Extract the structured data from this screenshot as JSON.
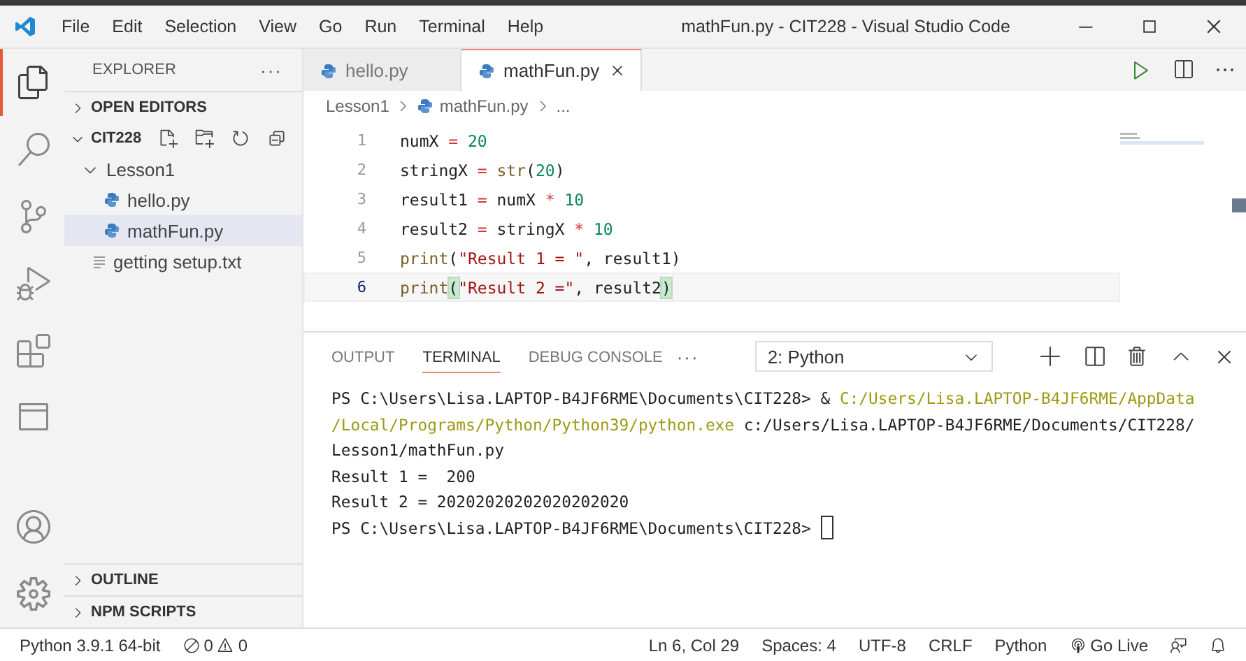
{
  "window": {
    "title": "mathFun.py - CIT228 - Visual Studio Code"
  },
  "menu": [
    "File",
    "Edit",
    "Selection",
    "View",
    "Go",
    "Run",
    "Terminal",
    "Help"
  ],
  "activity_bar": [
    {
      "kind": "files",
      "selected": true
    },
    {
      "kind": "search",
      "selected": false
    },
    {
      "kind": "scm",
      "selected": false
    },
    {
      "kind": "debug",
      "selected": false
    },
    {
      "kind": "extensions",
      "selected": false
    },
    {
      "kind": "browser",
      "selected": false
    }
  ],
  "activity_bottom": [
    {
      "kind": "account"
    },
    {
      "kind": "settings"
    }
  ],
  "sidebar": {
    "title": "EXPLORER",
    "more": "···",
    "sections_top": [
      {
        "label": "OPEN EDITORS",
        "expanded": false
      }
    ],
    "folder": {
      "label": "CIT228",
      "expanded": true,
      "children": [
        {
          "label": "Lesson1",
          "kind": "folder",
          "expanded": true,
          "selected": false,
          "children": [
            {
              "label": "hello.py",
              "kind": "python",
              "selected": false
            },
            {
              "label": "mathFun.py",
              "kind": "python",
              "selected": true
            }
          ]
        },
        {
          "label": "getting setup.txt",
          "kind": "text",
          "selected": false
        }
      ]
    },
    "sections_bottom": [
      {
        "label": "OUTLINE",
        "expanded": false
      },
      {
        "label": "NPM SCRIPTS",
        "expanded": false
      }
    ]
  },
  "tabs": [
    {
      "label": "hello.py",
      "selected": false
    },
    {
      "label": "mathFun.py",
      "selected": true
    }
  ],
  "breadcrumbs": [
    "Lesson1",
    "mathFun.py",
    "..."
  ],
  "editor": {
    "lines": [
      {
        "number": "1",
        "current": false,
        "tokens": [
          {
            "text": "numX ",
            "kind": "plain"
          },
          {
            "text": "=",
            "kind": "op"
          },
          {
            "text": " 20",
            "kind": "num"
          }
        ]
      },
      {
        "number": "2",
        "current": false,
        "tokens": [
          {
            "text": "stringX ",
            "kind": "plain"
          },
          {
            "text": "= ",
            "kind": "op"
          },
          {
            "text": "str",
            "kind": "fn"
          },
          {
            "text": "(",
            "kind": "plain"
          },
          {
            "text": "20",
            "kind": "num"
          },
          {
            "text": ")",
            "kind": "plain"
          }
        ]
      },
      {
        "number": "3",
        "current": false,
        "tokens": [
          {
            "text": "result1 ",
            "kind": "plain"
          },
          {
            "text": "=",
            "kind": "op"
          },
          {
            "text": " numX ",
            "kind": "plain"
          },
          {
            "text": "*",
            "kind": "op"
          },
          {
            "text": " 10",
            "kind": "num"
          }
        ]
      },
      {
        "number": "4",
        "current": false,
        "tokens": [
          {
            "text": "result2 ",
            "kind": "plain"
          },
          {
            "text": "=",
            "kind": "op"
          },
          {
            "text": " stringX ",
            "kind": "plain"
          },
          {
            "text": "*",
            "kind": "op"
          },
          {
            "text": " 10",
            "kind": "num"
          }
        ]
      },
      {
        "number": "5",
        "current": false,
        "tokens": [
          {
            "text": "print",
            "kind": "fn"
          },
          {
            "text": "(",
            "kind": "plain"
          },
          {
            "text": "\"Result 1 = \"",
            "kind": "str"
          },
          {
            "text": ", result1)",
            "kind": "plain"
          }
        ]
      },
      {
        "number": "6",
        "current": true,
        "tokens": [
          {
            "text": "print",
            "kind": "fn"
          },
          {
            "text": "(",
            "kind": "bracket"
          },
          {
            "text": "\"Result 2 =\"",
            "kind": "str"
          },
          {
            "text": ", result2",
            "kind": "plain"
          },
          {
            "text": ")",
            "kind": "bracket"
          }
        ]
      }
    ]
  },
  "panel": {
    "tabs": [
      {
        "label": "OUTPUT",
        "selected": false
      },
      {
        "label": "TERMINAL",
        "selected": true
      },
      {
        "label": "DEBUG CONSOLE",
        "selected": false
      }
    ],
    "more": "···",
    "terminal_select": "2: Python",
    "lines": [
      [
        {
          "text": "PS C:\\Users\\Lisa.LAPTOP-B4JF6RME\\Documents\\CIT228> & ",
          "kind": "plain"
        },
        {
          "text": "C:/Users/Lisa.LAPTOP-B4JF6RME/AppData",
          "kind": "path"
        }
      ],
      [
        {
          "text": "/Local/Programs/Python/Python39/python.exe",
          "kind": "path"
        },
        {
          "text": " c:/Users/Lisa.LAPTOP-B4JF6RME/Documents/CIT228/",
          "kind": "plain"
        }
      ],
      [
        {
          "text": "Lesson1/mathFun.py",
          "kind": "plain"
        }
      ],
      [
        {
          "text": "Result 1 =  200",
          "kind": "plain"
        }
      ],
      [
        {
          "text": "Result 2 = 20202020202020202020",
          "kind": "plain"
        }
      ],
      [
        {
          "text": "PS C:\\Users\\Lisa.LAPTOP-B4JF6RME\\Documents\\CIT228> ",
          "kind": "plain"
        }
      ]
    ]
  },
  "status_bar": {
    "interpreter": "Python 3.9.1 64-bit",
    "errors": "0",
    "warnings": "0",
    "position": "Ln 6, Col 29",
    "spaces": "Spaces: 4",
    "encoding": "UTF-8",
    "eol": "CRLF",
    "language": "Python",
    "live": "Go Live"
  }
}
